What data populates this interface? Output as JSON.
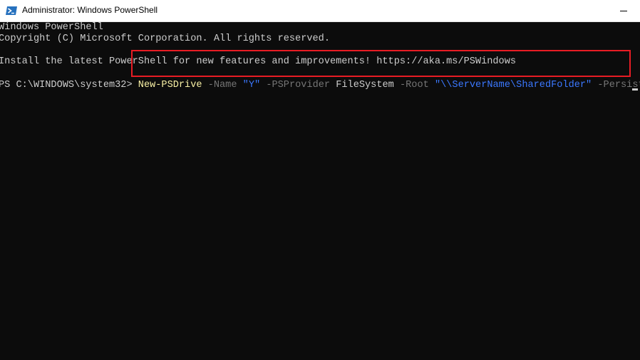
{
  "window": {
    "title": "Administrator: Windows PowerShell"
  },
  "console": {
    "header_line1": "Windows PowerShell",
    "header_line2": "Copyright (C) Microsoft Corporation. All rights reserved.",
    "info_line": "Install the latest PowerShell for new features and improvements! https://aka.ms/PSWindows",
    "prompt": "PS C:\\WINDOWS\\system32> ",
    "command": {
      "cmdlet": "New-PSDrive",
      "param_name": "-Name",
      "value_name": "\"Y\"",
      "param_provider": "-PSProvider",
      "value_provider": "FileSystem",
      "param_root": "-Root",
      "value_root": "\"\\\\ServerName\\SharedFolder\"",
      "param_persist": "-Persist"
    }
  },
  "colors": {
    "background": "#0c0c0c",
    "text": "#cccccc",
    "cmdlet": "#f9f1a5",
    "parameter": "#767676",
    "string": "#3b78ff",
    "highlight": "#e81c24"
  },
  "icons": {
    "app": "powershell-icon",
    "minimize": "minimize-icon"
  }
}
